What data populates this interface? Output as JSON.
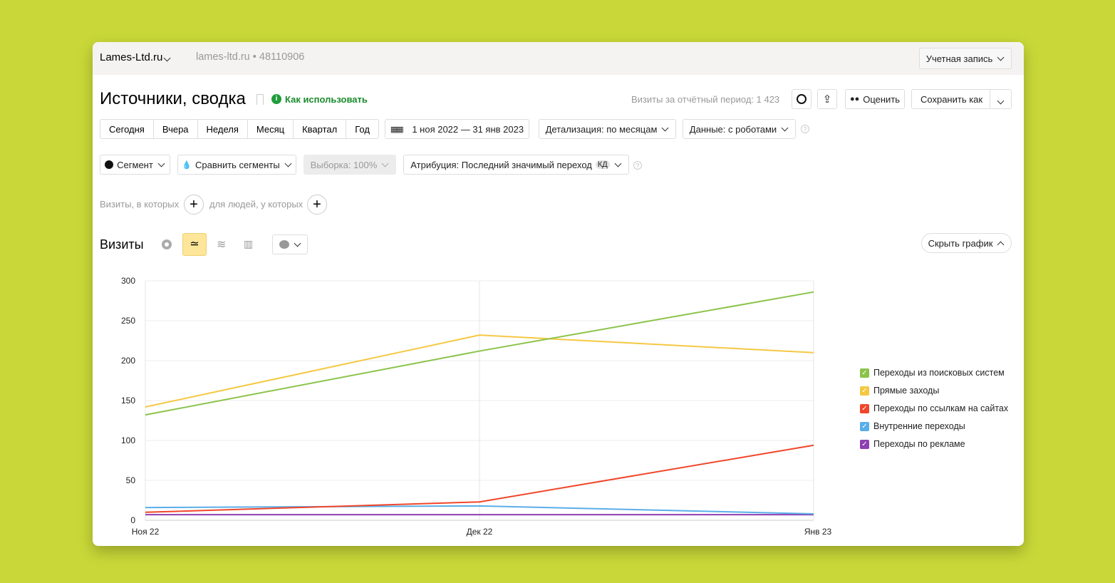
{
  "header": {
    "counter_name": "Lames-Ltd.ru",
    "site": "lames-ltd.ru",
    "counter_id": "48110906",
    "account": "Учетная запись"
  },
  "report": {
    "title": "Источники, сводка",
    "help": "Как использовать",
    "visits_total": "Визиты за отчётный период: 1 423",
    "rate": "Оценить",
    "save_as": "Сохранить как"
  },
  "periods": [
    "Сегодня",
    "Вчера",
    "Неделя",
    "Месяц",
    "Квартал",
    "Год"
  ],
  "date_range": "1 ноя 2022 — 31 янв 2023",
  "detail": "Детализация: по месяцам",
  "data_filter": "Данные: с роботами",
  "segment": "Сегмент",
  "compare": "Сравнить сегменты",
  "sample": "Выборка: 100%",
  "attribution": "Атрибуция: Последний значимый переход",
  "attribution_badge": "КД",
  "filter": {
    "visits": "Визиты, в которых",
    "people": "для людей, у которых",
    "help": "?"
  },
  "chart_section": {
    "title": "Визиты",
    "hide": "Скрыть график"
  },
  "chart_data": {
    "type": "line",
    "x": [
      "Ноя 22",
      "Дек 22",
      "Янв 23"
    ],
    "yticks": [
      0,
      50,
      100,
      150,
      200,
      250,
      300
    ],
    "ylim": [
      0,
      300
    ],
    "grid": true,
    "legend_position": "right",
    "series": [
      {
        "name": "Переходы из поисковых систем",
        "color": "#8bc34a",
        "values": [
          132,
          212,
          286
        ]
      },
      {
        "name": "Прямые заходы",
        "color": "#f5c842",
        "values": [
          142,
          232,
          210
        ]
      },
      {
        "name": "Переходы по ссылкам на сайтах",
        "color": "#f0462a",
        "values": [
          10,
          23,
          94
        ]
      },
      {
        "name": "Внутренние переходы",
        "color": "#5aaee8",
        "values": [
          16,
          18,
          8
        ]
      },
      {
        "name": "Переходы по рекламе",
        "color": "#8e3fb0",
        "values": [
          7,
          7,
          7
        ]
      }
    ]
  }
}
